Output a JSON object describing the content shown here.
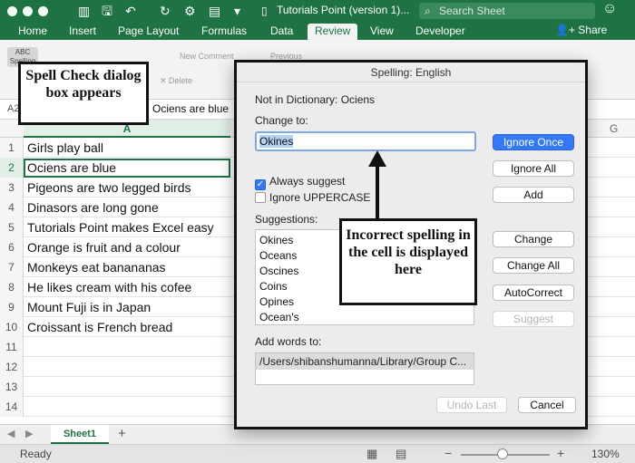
{
  "titlebar": {
    "title": "Tutorials Point (version 1)...",
    "search_placeholder": "Search Sheet"
  },
  "tabs": [
    "Home",
    "Insert",
    "Page Layout",
    "Formulas",
    "Data",
    "Review",
    "View",
    "Developer"
  ],
  "share_label": "Share",
  "ribbon": {
    "spelling_label": "Spelling",
    "new_comment": "New Comment",
    "previous": "Previous",
    "delete": "Delete"
  },
  "formula_bar": {
    "namebox": "A2",
    "content": "Ociens are blue"
  },
  "grid": {
    "col_a": "A",
    "col_g": "G",
    "rows": [
      {
        "n": "1",
        "text": "Girls play ball"
      },
      {
        "n": "2",
        "text": "Ociens are blue"
      },
      {
        "n": "3",
        "text": "Pigeons are two legged birds"
      },
      {
        "n": "4",
        "text": "Dinasors are long gone"
      },
      {
        "n": "5",
        "text": "Tutorials Point makes Excel easy"
      },
      {
        "n": "6",
        "text": "Orange is fruit and a colour"
      },
      {
        "n": "7",
        "text": "Monkeys eat banananas"
      },
      {
        "n": "8",
        "text": "He likes cream with his cofee"
      },
      {
        "n": "9",
        "text": "Mount Fuji is in Japan"
      },
      {
        "n": "10",
        "text": "Croissant is French bread"
      },
      {
        "n": "11",
        "text": ""
      },
      {
        "n": "12",
        "text": ""
      },
      {
        "n": "13",
        "text": ""
      },
      {
        "n": "14",
        "text": ""
      }
    ]
  },
  "sheet_tab": "Sheet1",
  "status": {
    "ready": "Ready",
    "zoom": "130%"
  },
  "dialog": {
    "title": "Spelling: English",
    "not_in_dict": "Not in Dictionary: Ociens",
    "change_to_label": "Change to:",
    "change_to_value": "Okines",
    "always_suggest": "Always suggest",
    "ignore_uppercase": "Ignore UPPERCASE",
    "suggestions_label": "Suggestions:",
    "suggestions": [
      "Okines",
      "Oceans",
      "Oscines",
      "Coins",
      "Opines",
      "Ocean's"
    ],
    "add_words_label": "Add words to:",
    "add_words_value": "/Users/shibanshumanna/Library/Group C...",
    "buttons": {
      "ignore_once": "Ignore Once",
      "ignore_all": "Ignore All",
      "add": "Add",
      "change": "Change",
      "change_all": "Change All",
      "autocorrect": "AutoCorrect",
      "suggest": "Suggest",
      "undo_last": "Undo Last",
      "cancel": "Cancel"
    }
  },
  "callouts": {
    "left": "Spell Check dialog box appears",
    "right": "Incorrect spelling in the cell is displayed here"
  },
  "colors": {
    "excel_green": "#1f7244",
    "primary_button": "#3478f6"
  }
}
